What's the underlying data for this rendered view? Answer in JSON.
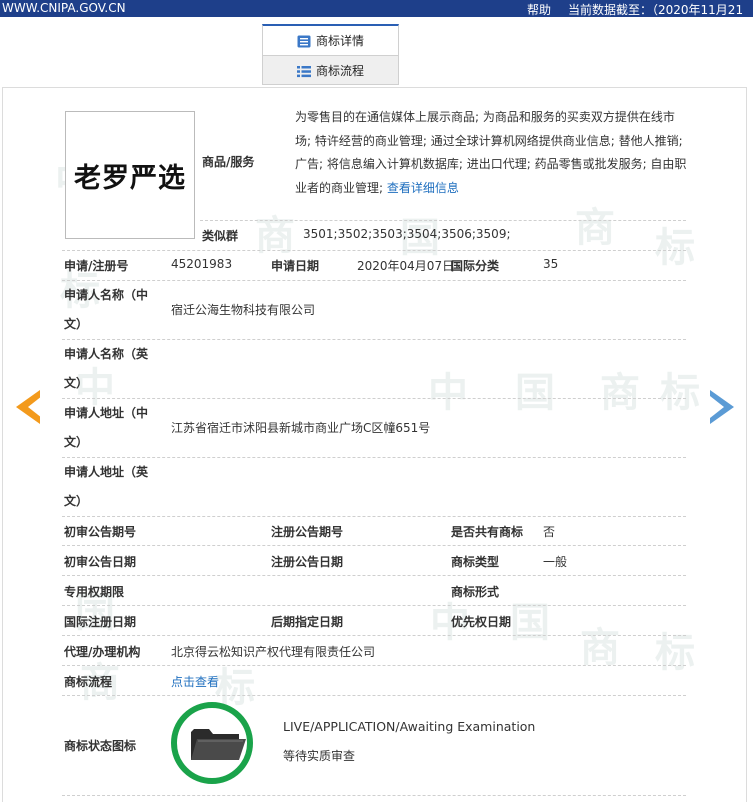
{
  "topbar": {
    "site": "WWW.CNIPA.GOV.CN",
    "help": "帮助",
    "data_date": "当前数据截至：（2020年11月21"
  },
  "tabs": [
    {
      "label": "商标详情",
      "icon": "document-icon",
      "active": true
    },
    {
      "label": "商标流程",
      "icon": "list-icon",
      "active": false
    }
  ],
  "colors": {
    "topbar": "#1e3f8a",
    "link": "#1f6fbf",
    "prev_arrow": "#f39a1c",
    "next_arrow": "#5b9bd5",
    "status_ring": "#1aa34a"
  },
  "watermark_chars": [
    "中",
    "国",
    "商",
    "标"
  ],
  "trademark": {
    "logo_text": "老罗严选",
    "goods_label": "商品/服务",
    "goods_text": "为零售目的在通信媒体上展示商品; 为商品和服务的买卖双方提供在线市场; 特许经营的商业管理; 通过全球计算机网络提供商业信息; 替他人推销; 广告; 将信息编入计算机数据库; 进出口代理; 药品零售或批发服务; 自由职业者的商业管理;",
    "goods_more": "查看详细信息",
    "similar_label": "类似群",
    "similar_value": "3501;3502;3503;3504;3506;3509;",
    "reg_no_label": "申请/注册号",
    "reg_no": "45201983",
    "app_date_label": "申请日期",
    "app_date": "2020年04月07日",
    "intl_class_label": "国际分类",
    "intl_class": "35",
    "applicant_cn_label": "申请人名称（中文）",
    "applicant_cn": "宿迁公海生物科技有限公司",
    "applicant_en_label": "申请人名称（英文）",
    "applicant_en": "",
    "address_cn_label": "申请人地址（中文）",
    "address_cn": "江苏省宿迁市沭阳县新城市商业广场C区幢651号",
    "address_en_label": "申请人地址（英文）",
    "address_en": "",
    "prelim_no_label": "初审公告期号",
    "prelim_no": "",
    "reg_pub_no_label": "注册公告期号",
    "reg_pub_no": "",
    "shared_label": "是否共有商标",
    "shared": "否",
    "prelim_date_label": "初审公告日期",
    "prelim_date": "",
    "reg_pub_date_label": "注册公告日期",
    "reg_pub_date": "",
    "type_label": "商标类型",
    "type": "一般",
    "exclusive_label": "专用权期限",
    "exclusive": "",
    "form_label": "商标形式",
    "form": "",
    "intl_reg_date_label": "国际注册日期",
    "intl_reg_date": "",
    "later_date_label": "后期指定日期",
    "later_date": "",
    "priority_label": "优先权日期",
    "priority": "",
    "agent_label": "代理/办理机构",
    "agent": "北京得云松知识产权代理有限责任公司",
    "process_label": "商标流程",
    "process_link": "点击查看",
    "status_icon_label": "商标状态图标",
    "status_en": "LIVE/APPLICATION/Awaiting Examination",
    "status_cn": "等待实质审查"
  }
}
